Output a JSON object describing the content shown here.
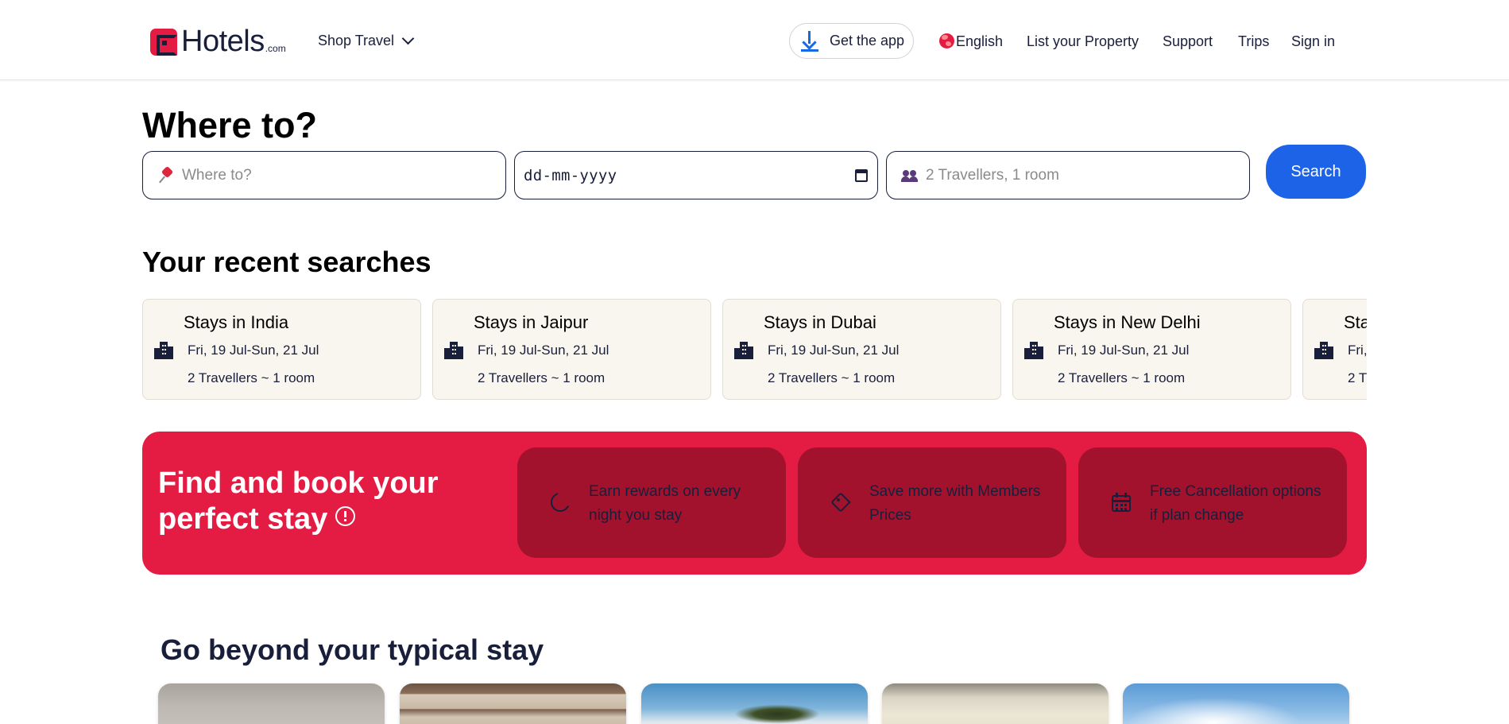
{
  "header": {
    "brand": "Hotels",
    "brand_suffix": ".com",
    "shop_travel": "Shop Travel",
    "get_app": "Get the app",
    "language": "English",
    "list_property": "List your Property",
    "support": "Support",
    "trips": "Trips",
    "sign_in": "Sign in"
  },
  "search": {
    "title": "Where to?",
    "destination_placeholder": "Where to?",
    "date_placeholder": "dd-mm-yyyy",
    "travellers_placeholder": "2 Travellers, 1 room",
    "button": "Search"
  },
  "recent": {
    "title": "Your recent searches",
    "items": [
      {
        "title": "Stays in India",
        "dates": "Fri, 19 Jul-Sun, 21 Jul",
        "travellers": "2 Travellers ~ 1 room"
      },
      {
        "title": "Stays in Jaipur",
        "dates": "Fri, 19 Jul-Sun, 21 Jul",
        "travellers": "2 Travellers ~ 1 room"
      },
      {
        "title": "Stays in Dubai",
        "dates": "Fri, 19 Jul-Sun, 21 Jul",
        "travellers": "2 Travellers ~ 1 room"
      },
      {
        "title": "Stays in New Delhi",
        "dates": "Fri, 19 Jul-Sun, 21 Jul",
        "travellers": "2 Travellers ~ 1 room"
      },
      {
        "title": "Sta",
        "dates": "Fri,",
        "travellers": "2 Tr"
      }
    ]
  },
  "promo": {
    "title": "Find and book your perfect stay",
    "cards": [
      {
        "icon": "moon-icon",
        "text": "Earn rewards on every night you stay"
      },
      {
        "icon": "tag-icon",
        "text": "Save more with Members Prices"
      },
      {
        "icon": "calendar-icon",
        "text": "Free Cancellation options if plan change"
      }
    ]
  },
  "beyond": {
    "title": "Go beyond your typical stay"
  },
  "colors": {
    "brand_red": "#e41c43",
    "promo_card": "#a3122d",
    "search_blue": "#1d63e8",
    "recent_card_bg": "#f9f6ef"
  }
}
